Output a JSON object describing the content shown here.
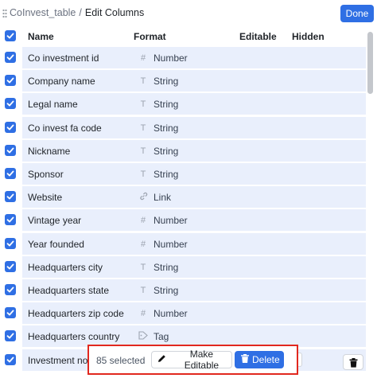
{
  "header": {
    "parent_table": "CoInvest_table",
    "separator": "/",
    "title": "Edit Columns",
    "done_label": "Done"
  },
  "columns": {
    "name": "Name",
    "format": "Format",
    "editable": "Editable",
    "hidden": "Hidden"
  },
  "rows": [
    {
      "name": "Co investment id",
      "format": "Number",
      "icon": "#"
    },
    {
      "name": "Company name",
      "format": "String",
      "icon": "T"
    },
    {
      "name": "Legal name",
      "format": "String",
      "icon": "T"
    },
    {
      "name": "Co invest fa code",
      "format": "String",
      "icon": "T"
    },
    {
      "name": "Nickname",
      "format": "String",
      "icon": "T"
    },
    {
      "name": "Sponsor",
      "format": "String",
      "icon": "T"
    },
    {
      "name": "Website",
      "format": "Link",
      "icon": "link"
    },
    {
      "name": "Vintage year",
      "format": "Number",
      "icon": "#"
    },
    {
      "name": "Year founded",
      "format": "Number",
      "icon": "#"
    },
    {
      "name": "Headquarters city",
      "format": "String",
      "icon": "T"
    },
    {
      "name": "Headquarters state",
      "format": "String",
      "icon": "T"
    },
    {
      "name": "Headquarters zip code",
      "format": "Number",
      "icon": "#"
    },
    {
      "name": "Headquarters country",
      "format": "Tag",
      "icon": "tag"
    },
    {
      "name": "Investment not",
      "format": "",
      "icon": ""
    }
  ],
  "action_bar": {
    "selected_text": "85 selected",
    "make_editable_label": "Make Editable",
    "delete_label": "Delete"
  },
  "colors": {
    "accent": "#2f6fe4",
    "row_selected": "#e9effc",
    "highlight_border": "#e1281f"
  }
}
